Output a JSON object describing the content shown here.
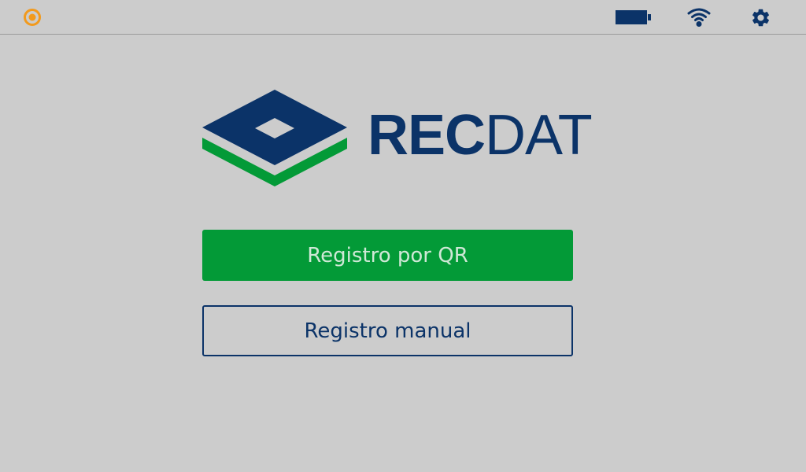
{
  "status_bar": {
    "indicator_icon": "status-dot-icon",
    "battery_icon": "battery-icon",
    "wifi_icon": "wifi-icon",
    "settings_icon": "gear-icon"
  },
  "brand": {
    "part_bold": "REC",
    "part_light": "DAT"
  },
  "buttons": {
    "qr_label": "Registro por QR",
    "manual_label": "Registro manual"
  },
  "colors": {
    "background": "#cccccc",
    "brand_blue": "#0b3368",
    "brand_green": "#039a37",
    "indicator_orange": "#f29a1d"
  }
}
